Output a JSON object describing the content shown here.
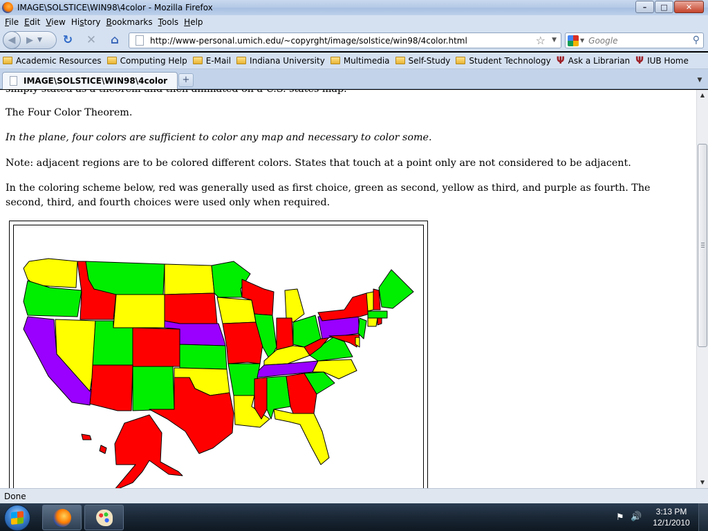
{
  "window": {
    "title": "IMAGE\\SOLSTICE\\WIN98\\4color - Mozilla Firefox",
    "controls": {
      "minimize": "–",
      "maximize": "□",
      "close": "✕"
    }
  },
  "menu": {
    "items": [
      {
        "label": "File",
        "key": "F",
        "rest": "ile"
      },
      {
        "label": "Edit",
        "key": "E",
        "rest": "dit"
      },
      {
        "label": "View",
        "key": "V",
        "rest": "iew"
      },
      {
        "label": "History",
        "pre": "Hi",
        "key": "s",
        "rest": "tory"
      },
      {
        "label": "Bookmarks",
        "key": "B",
        "rest": "ookmarks"
      },
      {
        "label": "Tools",
        "key": "T",
        "rest": "ools"
      },
      {
        "label": "Help",
        "key": "H",
        "rest": "elp"
      }
    ]
  },
  "nav": {
    "url": "http://www-personal.umich.edu/~copyrght/image/solstice/win98/4color.html",
    "search_placeholder": "Google"
  },
  "bookmarks": {
    "items": [
      {
        "label": "Academic Resources",
        "icon": "folder-icon"
      },
      {
        "label": "Computing Help",
        "icon": "folder-icon"
      },
      {
        "label": "E-Mail",
        "icon": "folder-icon"
      },
      {
        "label": "Indiana University",
        "icon": "folder-icon"
      },
      {
        "label": "Multimedia",
        "icon": "folder-icon"
      },
      {
        "label": "Self-Study",
        "icon": "folder-icon"
      },
      {
        "label": "Student Technology",
        "icon": "folder-icon"
      },
      {
        "label": "Ask a Librarian",
        "icon": "iu-trident-icon"
      },
      {
        "label": "IUB Home",
        "icon": "iu-trident-icon"
      }
    ]
  },
  "tabs": [
    {
      "label": "IMAGE\\SOLSTICE\\WIN98\\4color",
      "active": true
    }
  ],
  "content": {
    "cut_line": "simply stated as a theorem and then animated on a U.S. states map.",
    "heading": "The Four Color Theorem.",
    "theorem": "In the plane, four colors are sufficient to color any map and necessary to color some.",
    "note": "Note:  adjacent regions are to be colored different colors.  States that touch at a point only are not considered to be adjacent.",
    "scheme": "In the coloring scheme below, red was generally used as first choice, green as second, yellow as third, and purple as fourth.  The second, third, and fourth choices were used only when required."
  },
  "map_colors": {
    "red": "#ff0000",
    "green": "#00ee00",
    "yellow": "#ffff00",
    "purple": "#9900ff"
  },
  "status": {
    "text": "Done"
  },
  "taskbar": {
    "time": "3:13 PM",
    "date": "12/1/2010"
  }
}
